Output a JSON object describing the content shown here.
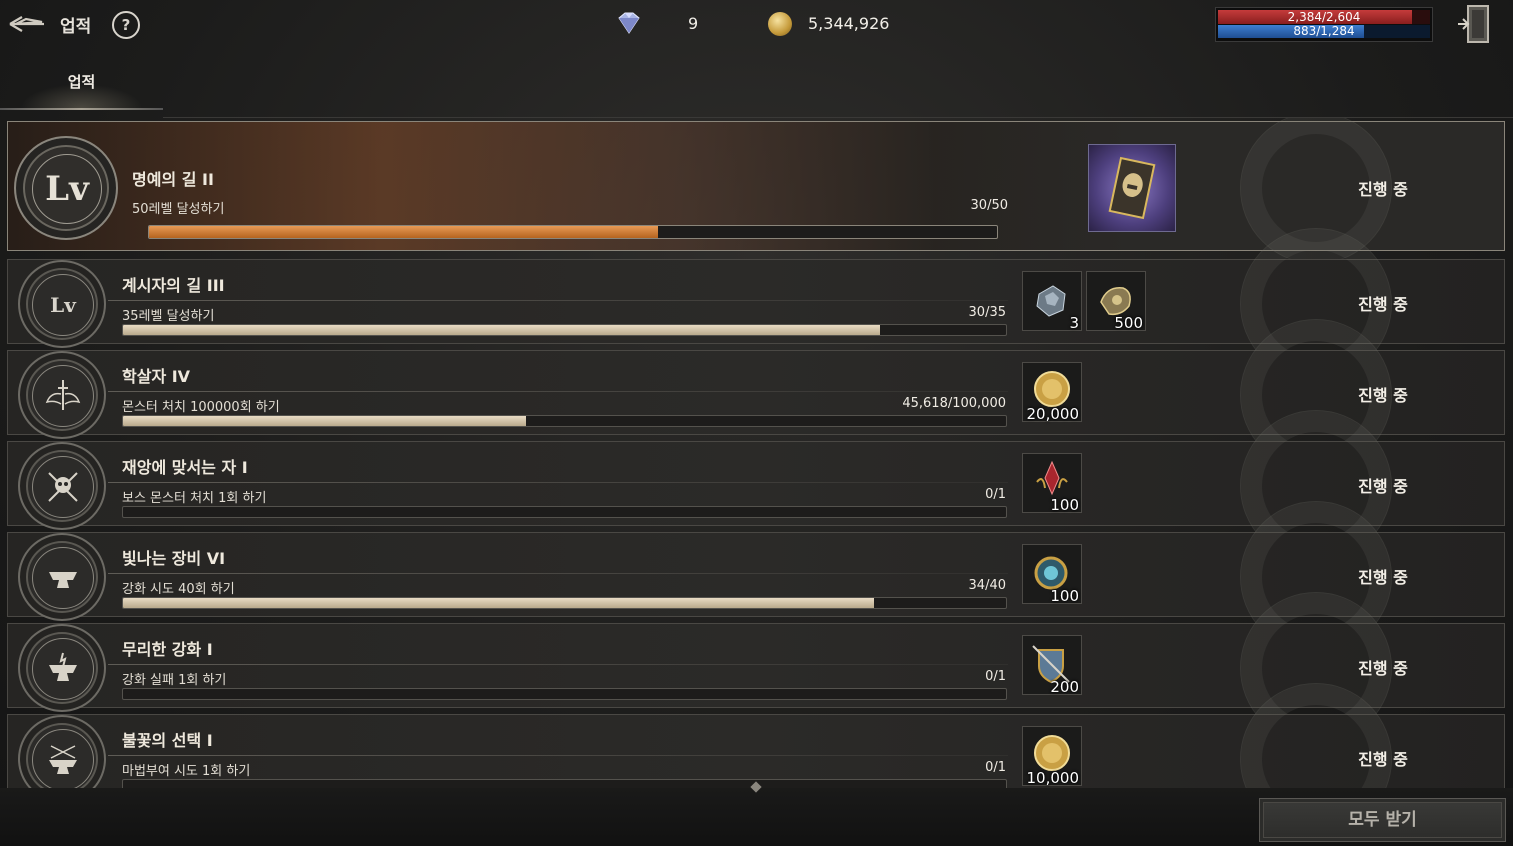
{
  "header": {
    "title": "업적",
    "help_label": "?",
    "gems": "9",
    "gold": "5,344,926",
    "hp": {
      "text": "2,384/2,604",
      "fraction": 0.915
    },
    "mp": {
      "text": "883/1,284",
      "fraction": 0.688
    }
  },
  "tabs": [
    {
      "label": "업적",
      "active": true
    }
  ],
  "achievements": [
    {
      "name": "명예의 길 II",
      "desc": "50레벨 달성하기",
      "progress": "30/50",
      "fraction": 0.6,
      "status": "진행 중",
      "rewards": [
        {
          "icon": "helmet-card-icon",
          "qty": ""
        }
      ]
    },
    {
      "name": "계시자의 길 III",
      "desc": "35레벨 달성하기",
      "progress": "30/35",
      "fraction": 0.857,
      "status": "진행 중",
      "rewards": [
        {
          "icon": "ore-icon",
          "qty": "3"
        },
        {
          "icon": "gauntlet-icon",
          "qty": "500"
        }
      ]
    },
    {
      "name": "학살자 IV",
      "desc": "몬스터 처치 100000회 하기",
      "progress": "45,618/100,000",
      "fraction": 0.456,
      "status": "진행 중",
      "rewards": [
        {
          "icon": "gold-coin-icon",
          "qty": "20,000"
        }
      ]
    },
    {
      "name": "재앙에 맞서는 자 I",
      "desc": "보스 몬스터 처치 1회 하기",
      "progress": "0/1",
      "fraction": 0,
      "status": "진행 중",
      "rewards": [
        {
          "icon": "red-crystal-icon",
          "qty": "100"
        }
      ]
    },
    {
      "name": "빛나는 장비 VI",
      "desc": "강화 시도 40회 하기",
      "progress": "34/40",
      "fraction": 0.85,
      "status": "진행 중",
      "rewards": [
        {
          "icon": "compass-orb-icon",
          "qty": "100"
        }
      ]
    },
    {
      "name": "무리한 강화 I",
      "desc": "강화 실패 1회 하기",
      "progress": "0/1",
      "fraction": 0,
      "status": "진행 중",
      "rewards": [
        {
          "icon": "shield-sword-icon",
          "qty": "200"
        }
      ]
    },
    {
      "name": "불꽃의 선택 I",
      "desc": "마법부여 시도 1회 하기",
      "progress": "0/1",
      "fraction": 0,
      "status": "진행 중",
      "rewards": [
        {
          "icon": "gold-coin-icon",
          "qty": "10,000"
        }
      ]
    }
  ],
  "footer": {
    "claim_all": "모두 받기"
  },
  "colors": {
    "accent_orange": "#d27a32",
    "hp_red": "#c53b3b",
    "mp_blue": "#3d7fd1",
    "bar_beige": "#d6c9ae"
  }
}
